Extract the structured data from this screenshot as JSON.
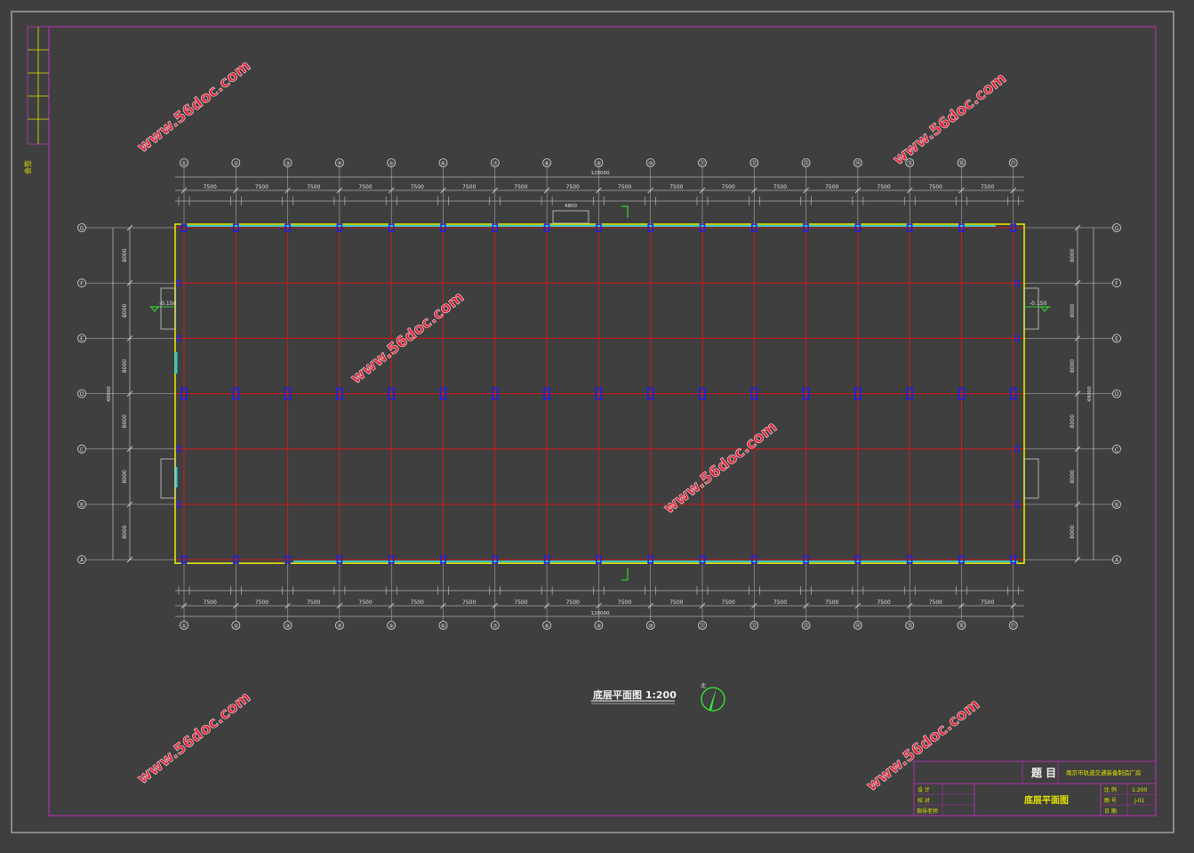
{
  "drawing": {
    "caption": "底层平面图 1:200",
    "north_label": "北"
  },
  "dimensions": {
    "bay": "7500",
    "total_length": "120000",
    "total_width": "48000",
    "top_extra": "4800",
    "col_pitch": "8000",
    "level_left": "-0.150",
    "level_right": "-0.150"
  },
  "axes": {
    "horizontal": [
      "①",
      "②",
      "③",
      "④",
      "⑤",
      "⑥",
      "⑦",
      "⑧",
      "⑨",
      "⑩",
      "⑪",
      "⑫",
      "⑬",
      "⑭",
      "⑮",
      "⑯",
      "⑰"
    ],
    "vertical": [
      "G",
      "F",
      "E",
      "D",
      "C",
      "B",
      "A"
    ]
  },
  "watermark": "www.56doc.com",
  "title_block": {
    "title_label": "题 目",
    "project": "南京市轨道交通装备制造厂房",
    "sheet_name": "底层平面图",
    "rows_left": [
      "设 计",
      "校 对",
      "指导老师"
    ],
    "rows_right": [
      "比 例",
      "图 号",
      "日 期"
    ],
    "scale": "1:200",
    "sheet_no": "J-01"
  },
  "binding_strip": {
    "label": "会签"
  },
  "colors": {
    "background": "#3f3f3f",
    "frame": "#aa33aa",
    "grid": "#d21919",
    "wall": "#e6e600",
    "window": "#33cccc",
    "column": "#2222dd",
    "dim": "#e0e0e0",
    "watermark": "#e0243a",
    "north": "#33ee33"
  }
}
